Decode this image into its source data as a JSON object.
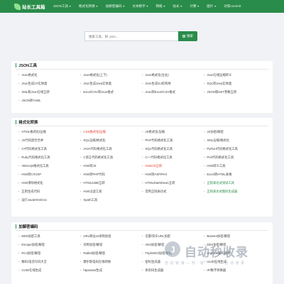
{
  "header": {
    "logo_text": "站长工具箱",
    "nav": [
      {
        "label": "JSON工具",
        "caret": true
      },
      {
        "label": "格式化转换",
        "caret": true
      },
      {
        "label": "加解密编码",
        "caret": true
      },
      {
        "label": "文本数字",
        "caret": true
      },
      {
        "label": "网络",
        "caret": true
      },
      {
        "label": "站长",
        "caret": true
      },
      {
        "label": "计算",
        "caret": true
      },
      {
        "label": "图片",
        "caret": true
      },
      {
        "label": "对照commit",
        "caret": false
      }
    ],
    "colors": {
      "primary": "#2a8c4a"
    }
  },
  "search": {
    "placeholder": "搜索工具、如: json...",
    "button_label": "搜索"
  },
  "sections": [
    {
      "title": "JSON工具",
      "items": [
        {
          "label": "Json格式化",
          "color": ""
        },
        {
          "label": "Json格式化(上下)",
          "color": ""
        },
        {
          "label": "Json格式化(左右)",
          "color": ""
        },
        {
          "label": "Json在线压缩转义",
          "color": ""
        },
        {
          "label": "Json生成C#实体类",
          "color": ""
        },
        {
          "label": "Json生成Java实体类",
          "color": ""
        },
        {
          "label": "Json生成Go结构体",
          "color": ""
        },
        {
          "label": "SQL转Java实体类",
          "color": ""
        },
        {
          "label": "XML和Json在线互转",
          "color": ""
        },
        {
          "label": "Excel/CSV转Json格式",
          "color": ""
        },
        {
          "label": "Json转Excel/CSV格式",
          "color": ""
        },
        {
          "label": "JSON和GET参数互转",
          "color": ""
        },
        {
          "label": "JSON转YAML",
          "color": ""
        }
      ]
    },
    {
      "title": "格式化转换",
      "items": [
        {
          "label": "HTML格式化/压缩",
          "color": ""
        },
        {
          "label": "CSS格式化/压缩",
          "color": "red"
        },
        {
          "label": "JS格式化/压缩",
          "color": ""
        },
        {
          "label": "JS加密/解密",
          "color": ""
        },
        {
          "label": "JS代码混合合并",
          "color": ""
        },
        {
          "label": "SQL压缩/格式化",
          "color": ""
        },
        {
          "label": "PHP代码格式化工具",
          "color": ""
        },
        {
          "label": "XML压缩/格式化",
          "color": ""
        },
        {
          "label": "C#代码格式化工具",
          "color": ""
        },
        {
          "label": "JAVA代码格式化工具",
          "color": ""
        },
        {
          "label": "SQL代码格式化工具",
          "color": ""
        },
        {
          "label": "Python代码格式化工具",
          "color": ""
        },
        {
          "label": "Ruby代码格式化工具",
          "color": ""
        },
        {
          "label": "C语言代码格式化工具",
          "color": ""
        },
        {
          "label": "C++代码格式化工具",
          "color": ""
        },
        {
          "label": "Perl代码格式化工具",
          "color": ""
        },
        {
          "label": "VBScript格式化工具",
          "color": ""
        },
        {
          "label": "Html转JS",
          "color": ""
        },
        {
          "label": "Html/JS互转",
          "color": "red"
        },
        {
          "label": "Html转义工具",
          "color": ""
        },
        {
          "label": "Html转C#/JSP",
          "color": ""
        },
        {
          "label": "Html转PHP代码",
          "color": ""
        },
        {
          "label": "Html转ASP/Perl",
          "color": ""
        },
        {
          "label": "Excel转HTML表格",
          "color": ""
        },
        {
          "label": "Html清除格式化",
          "color": ""
        },
        {
          "label": "HTML/UBB互转",
          "color": ""
        },
        {
          "label": "HTML/MarkDown互转",
          "color": ""
        },
        {
          "label": "正则表达式测试工具",
          "color": "green"
        },
        {
          "label": "正则生成代码",
          "color": ""
        },
        {
          "label": "Html过滤工具",
          "color": ""
        },
        {
          "label": "常用正则表达式",
          "color": ""
        },
        {
          "label": "正则表达式图形生成器",
          "color": "green"
        },
        {
          "label": "运行Java/Html/css",
          "color": ""
        },
        {
          "label": "Xpath工具",
          "color": ""
        }
      ]
    },
    {
      "title": "加解密编码",
      "items": [
        {
          "label": "MD5加密工具",
          "color": ""
        },
        {
          "label": "URL网址16进制加密",
          "color": ""
        },
        {
          "label": "迅雷/快车URL加密",
          "color": ""
        },
        {
          "label": "Base64加密/解密",
          "color": ""
        },
        {
          "label": "Escape加密/解密",
          "color": ""
        },
        {
          "label": "对称加密/解密",
          "color": ""
        },
        {
          "label": "AES加密/解密",
          "color": ""
        },
        {
          "label": "DES加密/解密",
          "color": ""
        },
        {
          "label": "RC4加密/解密",
          "color": ""
        },
        {
          "label": "Rabbit加密/解密",
          "color": ""
        },
        {
          "label": "TripleDES加密/解密",
          "color": ""
        },
        {
          "label": "Unicode编码转换",
          "color": ""
        },
        {
          "label": "数码/电话号码大全",
          "color": ""
        },
        {
          "label": "摩尔斯电码在线转换",
          "color": ""
        },
        {
          "label": "密码生成器",
          "color": ""
        },
        {
          "label": "UUID在线生成",
          "color": ""
        },
        {
          "label": "GUID在线生成",
          "color": ""
        },
        {
          "label": "htpasswd生成",
          "color": ""
        },
        {
          "label": "条形码生成器",
          "color": ""
        },
        {
          "label": "IP/数字转换器",
          "color": ""
        }
      ]
    }
  ],
  "watermark": {
    "brand": "自动秒收录",
    "slogan": "自 动 链 接 — 秒 · 速 · 一 次 → 自 动 收 录"
  }
}
